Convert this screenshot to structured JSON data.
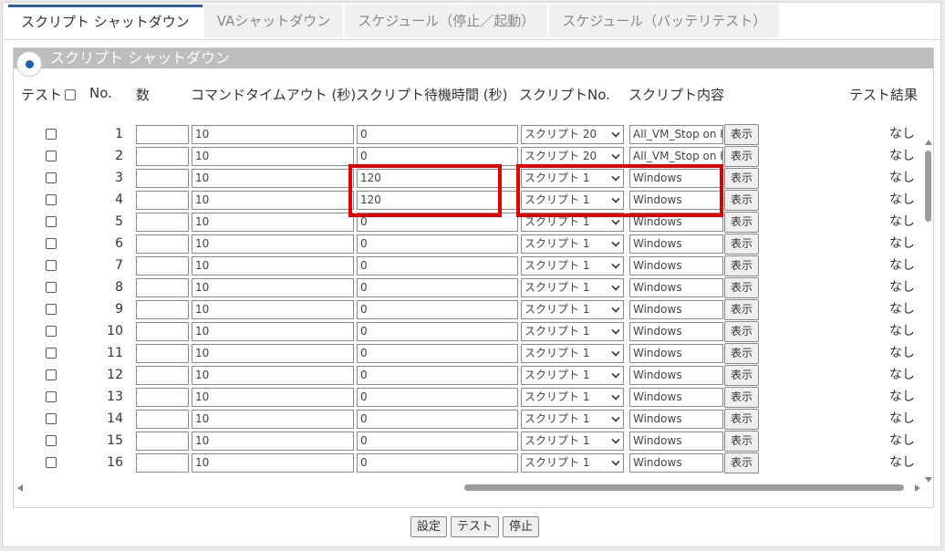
{
  "tabs": [
    {
      "label": "スクリプト シャットダウン",
      "active": true
    },
    {
      "label": "VAシャットダウン",
      "active": false
    },
    {
      "label": "スケジュール（停止／起動）",
      "active": false
    },
    {
      "label": "スケジュール（バッテリテスト）",
      "active": false
    }
  ],
  "panel": {
    "title": "スクリプト シャットダウン",
    "headers": {
      "test": "テスト",
      "no": "No.",
      "count": "数",
      "timeout": "コマンドタイムアウト (秒)",
      "wait": "スクリプト待機時間 (秒)",
      "script_no": "スクリプトNo.",
      "content": "スクリプト内容",
      "result": "テスト結果"
    }
  },
  "rows": [
    {
      "no": "1",
      "count": "",
      "timeout": "10",
      "wait": "0",
      "script": "スクリプト 20",
      "content": "All_VM_Stop on H",
      "show": "表示",
      "result": "なし"
    },
    {
      "no": "2",
      "count": "",
      "timeout": "10",
      "wait": "0",
      "script": "スクリプト 20",
      "content": "All_VM_Stop on H",
      "show": "表示",
      "result": "なし"
    },
    {
      "no": "3",
      "count": "",
      "timeout": "10",
      "wait": "120",
      "script": "スクリプト 1",
      "content": "Windows",
      "show": "表示",
      "result": "なし"
    },
    {
      "no": "4",
      "count": "",
      "timeout": "10",
      "wait": "120",
      "script": "スクリプト 1",
      "content": "Windows",
      "show": "表示",
      "result": "なし"
    },
    {
      "no": "5",
      "count": "",
      "timeout": "10",
      "wait": "0",
      "script": "スクリプト 1",
      "content": "Windows",
      "show": "表示",
      "result": "なし"
    },
    {
      "no": "6",
      "count": "",
      "timeout": "10",
      "wait": "0",
      "script": "スクリプト 1",
      "content": "Windows",
      "show": "表示",
      "result": "なし"
    },
    {
      "no": "7",
      "count": "",
      "timeout": "10",
      "wait": "0",
      "script": "スクリプト 1",
      "content": "Windows",
      "show": "表示",
      "result": "なし"
    },
    {
      "no": "8",
      "count": "",
      "timeout": "10",
      "wait": "0",
      "script": "スクリプト 1",
      "content": "Windows",
      "show": "表示",
      "result": "なし"
    },
    {
      "no": "9",
      "count": "",
      "timeout": "10",
      "wait": "0",
      "script": "スクリプト 1",
      "content": "Windows",
      "show": "表示",
      "result": "なし"
    },
    {
      "no": "10",
      "count": "",
      "timeout": "10",
      "wait": "0",
      "script": "スクリプト 1",
      "content": "Windows",
      "show": "表示",
      "result": "なし"
    },
    {
      "no": "11",
      "count": "",
      "timeout": "10",
      "wait": "0",
      "script": "スクリプト 1",
      "content": "Windows",
      "show": "表示",
      "result": "なし"
    },
    {
      "no": "12",
      "count": "",
      "timeout": "10",
      "wait": "0",
      "script": "スクリプト 1",
      "content": "Windows",
      "show": "表示",
      "result": "なし"
    },
    {
      "no": "13",
      "count": "",
      "timeout": "10",
      "wait": "0",
      "script": "スクリプト 1",
      "content": "Windows",
      "show": "表示",
      "result": "なし"
    },
    {
      "no": "14",
      "count": "",
      "timeout": "10",
      "wait": "0",
      "script": "スクリプト 1",
      "content": "Windows",
      "show": "表示",
      "result": "なし"
    },
    {
      "no": "15",
      "count": "",
      "timeout": "10",
      "wait": "0",
      "script": "スクリプト 1",
      "content": "Windows",
      "show": "表示",
      "result": "なし"
    },
    {
      "no": "16",
      "count": "",
      "timeout": "10",
      "wait": "0",
      "script": "スクリプト 1",
      "content": "Windows",
      "show": "表示",
      "result": "なし"
    }
  ],
  "footer": {
    "set": "設定",
    "test": "テスト",
    "stop": "停止"
  }
}
